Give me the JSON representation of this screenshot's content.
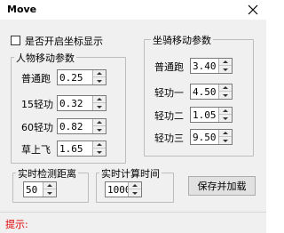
{
  "window": {
    "title": "Move"
  },
  "checkbox": {
    "label": "是否开启坐标显示",
    "checked": false
  },
  "character_group": {
    "title": "人物移动参数",
    "rows": [
      {
        "label": "普通跑",
        "value": "0.25"
      },
      {
        "label": "15轻功",
        "value": "0.32"
      },
      {
        "label": "60轻功",
        "value": "0.82"
      },
      {
        "label": "草上飞",
        "value": "1.65"
      }
    ]
  },
  "mount_group": {
    "title": "坐骑移动参数",
    "rows": [
      {
        "label": "普通跑",
        "value": "3.40"
      },
      {
        "label": "轻功一",
        "value": "4.50"
      },
      {
        "label": "轻功二",
        "value": "1.05"
      },
      {
        "label": "轻功三",
        "value": "9.50"
      }
    ]
  },
  "detect_group": {
    "title": "实时检测距离",
    "value": "50"
  },
  "calc_group": {
    "title": "实时计算时间",
    "value": "1000"
  },
  "buttons": {
    "save": "保存并加载"
  },
  "status": {
    "hint": "提示:"
  }
}
